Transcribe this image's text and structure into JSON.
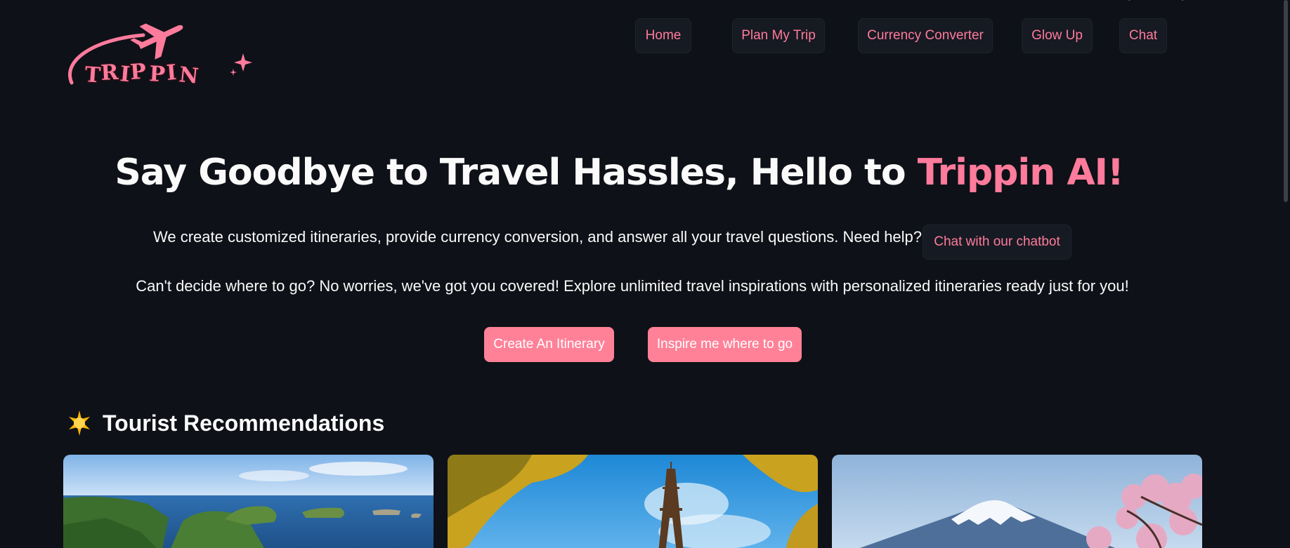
{
  "brand": {
    "logo_text": "TRIPPIN"
  },
  "nav": {
    "items": [
      {
        "label": "Home"
      },
      {
        "label": "Plan My Trip"
      },
      {
        "label": "Currency Converter"
      },
      {
        "label": "Glow Up"
      },
      {
        "label": "Chat"
      }
    ]
  },
  "hero": {
    "title_main": "Say Goodbye to Travel Hassles, Hello to ",
    "title_accent": "Trippin AI!",
    "description": "We create customized itineraries, provide currency conversion, and answer all your travel questions. Need help?",
    "chat_button": "Chat with our chatbot",
    "inspiration": "Can't decide where to go? No worries, we've got you covered! Explore unlimited travel inspirations with personalized itineraries ready just for you!",
    "create_button": "Create An Itinerary",
    "inspire_button": "Inspire me where to go"
  },
  "recommendations": {
    "title": "Tourist Recommendations",
    "icon": "glowing-star-icon",
    "cards": [
      {
        "icon": "coastal-cliffs-image"
      },
      {
        "icon": "eiffel-tower-image"
      },
      {
        "icon": "mount-fuji-image"
      }
    ]
  },
  "colors": {
    "background": "#0e1117",
    "accent": "#ff7b9c",
    "button_fill": "#ff8198",
    "nav_button_bg": "#161a22"
  }
}
